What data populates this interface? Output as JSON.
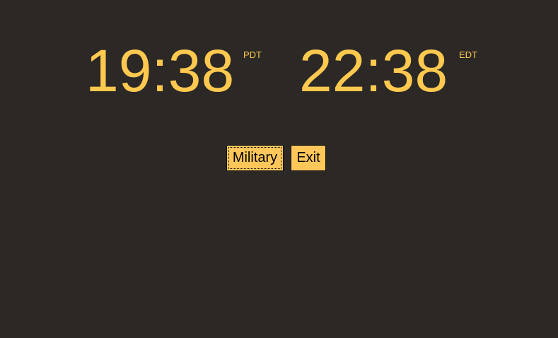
{
  "clocks": [
    {
      "time": "19:38",
      "timezone": "PDT"
    },
    {
      "time": "22:38",
      "timezone": "EDT"
    }
  ],
  "buttons": {
    "military_label": "Military",
    "exit_label": "Exit"
  },
  "colors": {
    "background": "#2b2826",
    "clock_text": "#ffc94f",
    "button_background": "#ffc75a"
  }
}
